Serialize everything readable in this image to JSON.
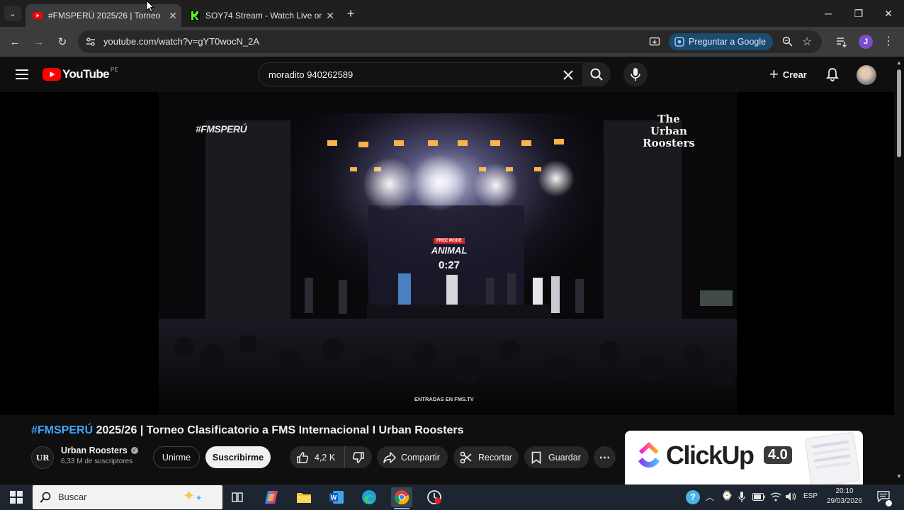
{
  "browser": {
    "tabs": [
      {
        "title": "#FMSPERÚ 2025/26 | Torneo",
        "active": true
      },
      {
        "title": "SOY74 Stream - Watch Live on",
        "active": false
      }
    ],
    "url": "youtube.com/watch?v=gYT0wocN_2A",
    "ask_google": "Preguntar a Google",
    "profile_initial": "J"
  },
  "youtube": {
    "logo_text": "YouTube",
    "region": "PE",
    "search_value": "moradito 940262589",
    "create_label": "Crear"
  },
  "video": {
    "overlay_left": "#FMSPERÚ",
    "overlay_right_line1": "The Urban",
    "overlay_right_line2": "Roosters",
    "stage_tag": "FREE MODE",
    "stage_mode": "ANIMAL",
    "stage_timer": "0:27",
    "tickets": "ENTRADAS EN FMS.TV"
  },
  "details": {
    "title_tag": "#FMSPERÚ",
    "title_rest": " 2025/26 | Torneo Clasificatorio a FMS Internacional I Urban Roosters",
    "channel_name": "Urban Roosters",
    "subscribers": "6,33 M de suscriptores",
    "join_label": "Unirme",
    "subscribe_label": "Suscribirme",
    "likes": "4,2 K",
    "share_label": "Compartir",
    "clip_label": "Recortar",
    "save_label": "Guardar"
  },
  "ad": {
    "brand": "ClickUp",
    "version": "4.0"
  },
  "taskbar": {
    "search_placeholder": "Buscar",
    "language": "ESP",
    "time": "20:10",
    "date": "29/03/2026"
  },
  "colors": {
    "youtube_red": "#ff0000",
    "link_blue": "#3ea6ff",
    "taskbar_bg": "#1c2530"
  }
}
